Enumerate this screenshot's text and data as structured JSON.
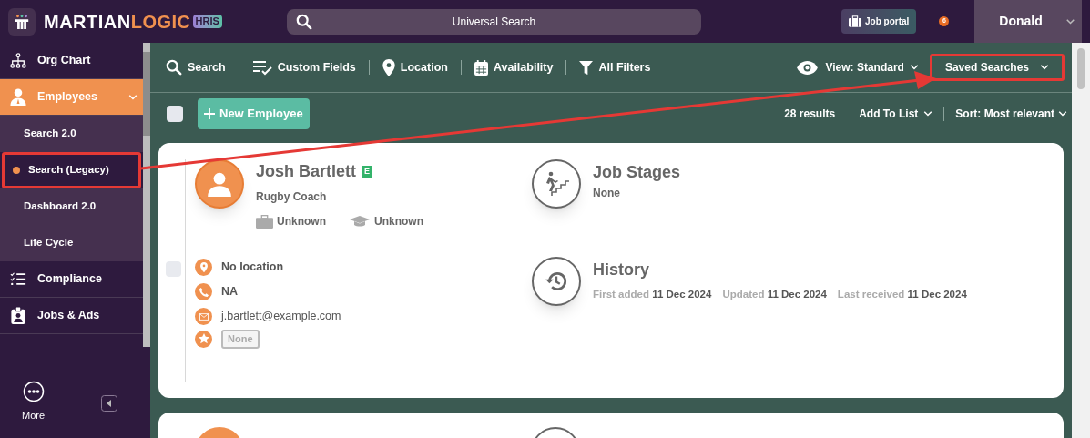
{
  "header": {
    "logo_main": "MARTIAN",
    "logo_accent": "LOGIC",
    "logo_badge": "HRIS",
    "search_placeholder": "Universal Search",
    "job_portal": "Job portal",
    "notification_count": "6",
    "user": "Donald"
  },
  "sidebar": {
    "items": [
      {
        "kind": "section",
        "label": "Org Chart",
        "selected": false,
        "expanded": false
      },
      {
        "kind": "section",
        "label": "Employees",
        "selected": true,
        "expanded": true
      },
      {
        "kind": "sub",
        "label": "Search 2.0",
        "selected": false,
        "highlighted": false
      },
      {
        "kind": "sub",
        "label": "Search (Legacy)",
        "selected": true,
        "highlighted": true
      },
      {
        "kind": "sub",
        "label": "Dashboard 2.0",
        "selected": false,
        "highlighted": false
      },
      {
        "kind": "sub",
        "label": "Life Cycle",
        "selected": false,
        "highlighted": false
      },
      {
        "kind": "section",
        "label": "Compliance",
        "selected": false,
        "expanded": false
      },
      {
        "kind": "section",
        "label": "Jobs & Ads",
        "selected": false,
        "expanded": false
      }
    ],
    "more": "More"
  },
  "toolbar": {
    "filters": [
      {
        "label": "Search"
      },
      {
        "label": "Custom Fields"
      },
      {
        "label": "Location"
      },
      {
        "label": "Availability"
      },
      {
        "label": "All Filters"
      }
    ],
    "view": "View: Standard",
    "saved_searches": {
      "label": "Saved Searches",
      "highlighted": true
    }
  },
  "results_bar": {
    "select_all_checked": false,
    "new_button": "New Employee",
    "count": "28 results",
    "add_to_list": "Add To List",
    "sort": "Sort: Most relevant"
  },
  "employees": [
    {
      "name": "Josh Bartlett",
      "badge": "E",
      "title": "Rugby Coach",
      "work": "Unknown",
      "education": "Unknown",
      "checked": false,
      "location": "No location",
      "phone": "NA",
      "email": "j.bartlett@example.com",
      "tag": "None",
      "job_stages_title": "Job Stages",
      "job_stages_value": "None",
      "history_title": "History",
      "history": [
        {
          "label": "First added",
          "value": "11 Dec 2024"
        },
        {
          "label": "Updated",
          "value": "11 Dec 2024"
        },
        {
          "label": "Last received",
          "value": "11 Dec 2024"
        }
      ]
    }
  ]
}
